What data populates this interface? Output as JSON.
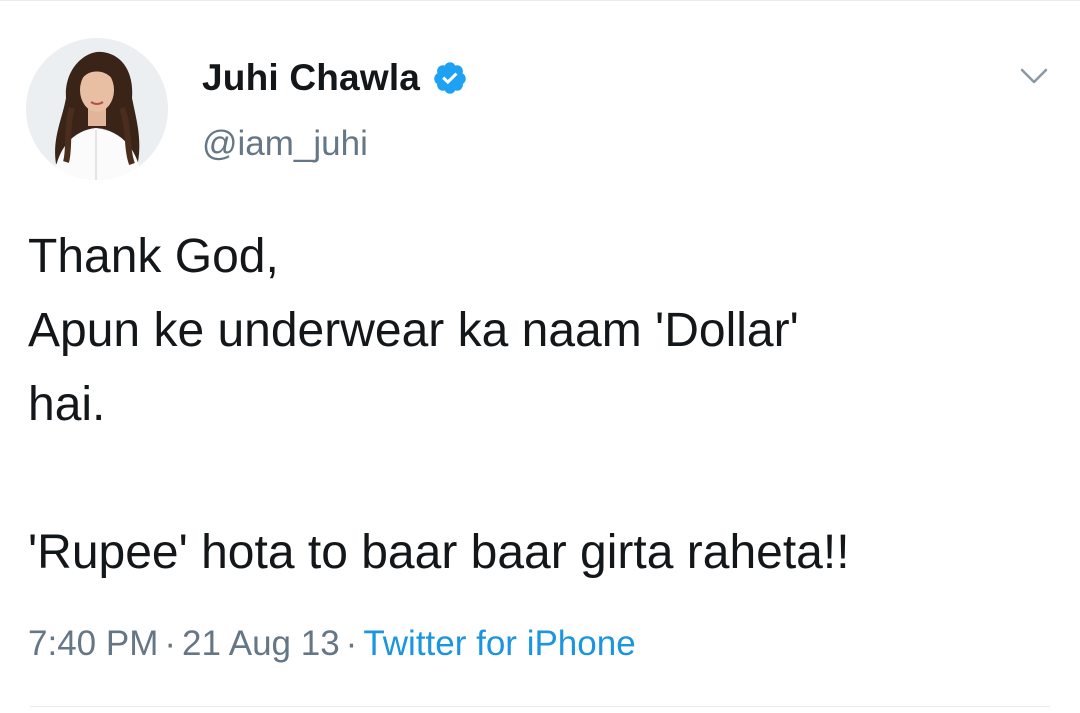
{
  "tweet": {
    "author": {
      "display_name": "Juhi Chawla",
      "handle": "@iam_juhi",
      "verified": true,
      "avatar_icon": "profile-photo"
    },
    "text_lines": [
      "Thank God,",
      "Apun ke underwear ka naam 'Dollar'",
      "hai.",
      "",
      "'Rupee' hota to baar baar girta raheta!!"
    ],
    "meta": {
      "time": "7:40 PM",
      "separator": "·",
      "date": "21 Aug 13",
      "source": "Twitter for iPhone"
    }
  },
  "colors": {
    "text": "#14171a",
    "secondary": "#657786",
    "link": "#1b95e0",
    "verified_badge": "#1da1f2",
    "divider": "#e6ecf0"
  },
  "icons": {
    "verified": "verified-badge-icon",
    "menu": "chevron-down-icon"
  }
}
